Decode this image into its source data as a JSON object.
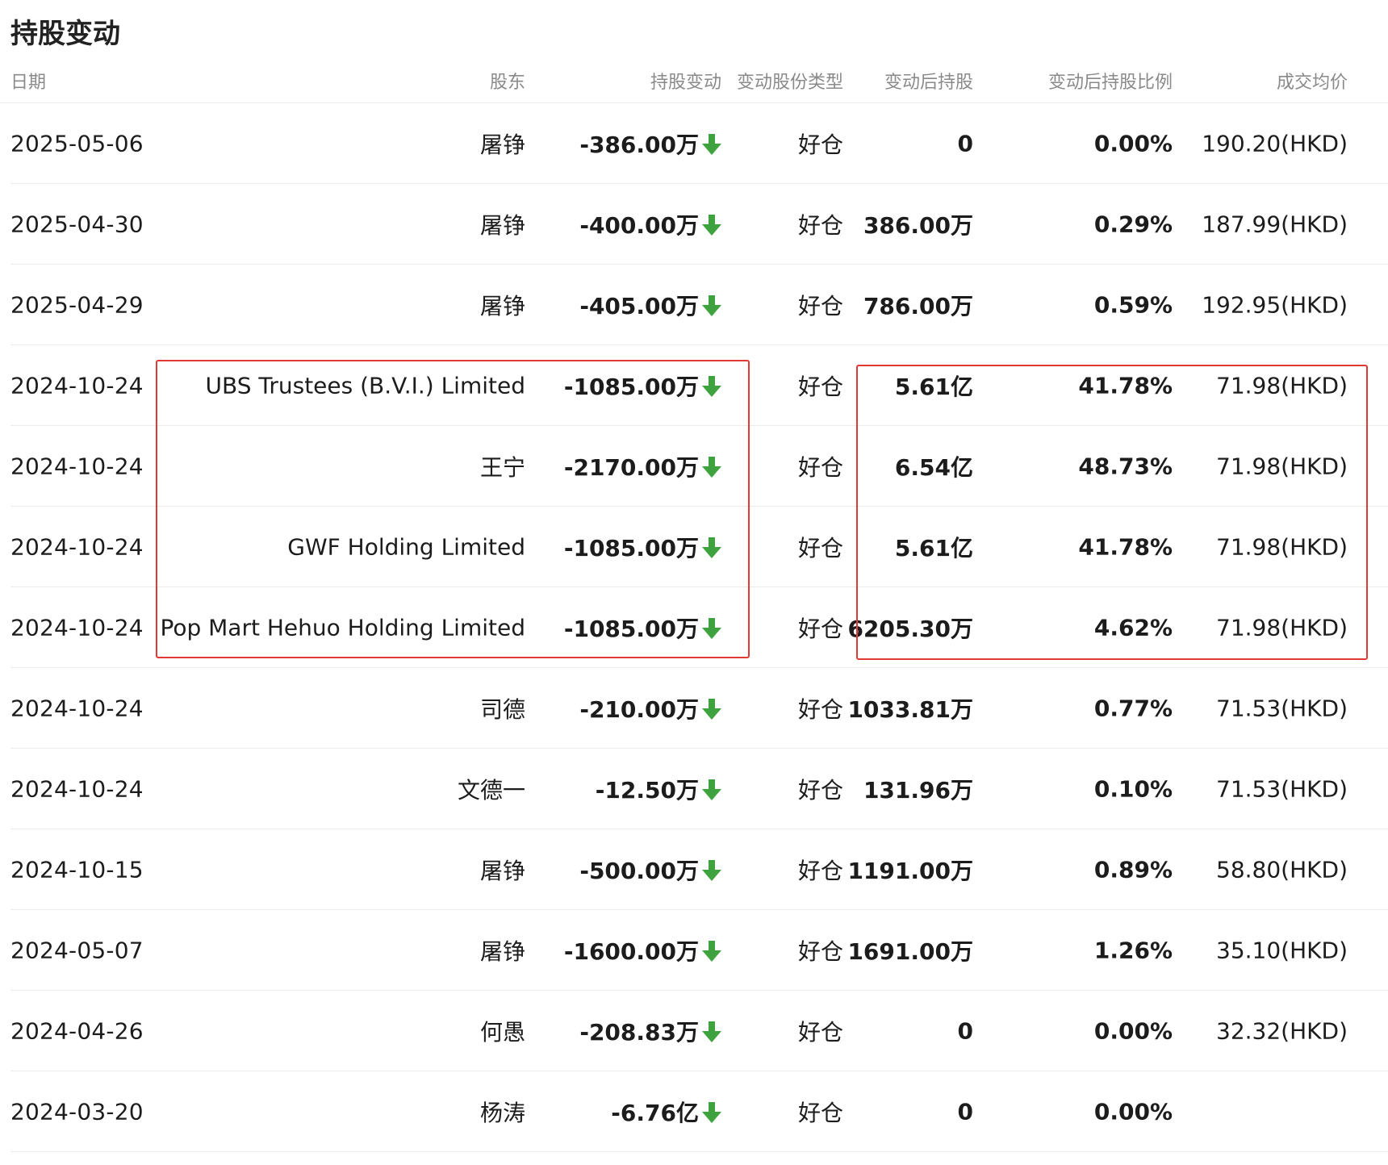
{
  "page": {
    "title": "持股变动"
  },
  "columns": {
    "date": "日期",
    "holder": "股东",
    "change": "持股变动",
    "share_type": "变动股份类型",
    "after_holding": "变动后持股",
    "after_ratio": "变动后持股比例",
    "avg_price": "成交均价"
  },
  "rows": [
    {
      "date": "2025-05-06",
      "holder": "屠铮",
      "change": "-386.00万",
      "share_type": "好仓",
      "after_holding": "0",
      "after_ratio": "0.00%",
      "avg_price": "190.20(HKD)"
    },
    {
      "date": "2025-04-30",
      "holder": "屠铮",
      "change": "-400.00万",
      "share_type": "好仓",
      "after_holding": "386.00万",
      "after_ratio": "0.29%",
      "avg_price": "187.99(HKD)"
    },
    {
      "date": "2025-04-29",
      "holder": "屠铮",
      "change": "-405.00万",
      "share_type": "好仓",
      "after_holding": "786.00万",
      "after_ratio": "0.59%",
      "avg_price": "192.95(HKD)"
    },
    {
      "date": "2024-10-24",
      "holder": "UBS Trustees (B.V.I.) Limited",
      "change": "-1085.00万",
      "share_type": "好仓",
      "after_holding": "5.61亿",
      "after_ratio": "41.78%",
      "avg_price": "71.98(HKD)"
    },
    {
      "date": "2024-10-24",
      "holder": "王宁",
      "change": "-2170.00万",
      "share_type": "好仓",
      "after_holding": "6.54亿",
      "after_ratio": "48.73%",
      "avg_price": "71.98(HKD)"
    },
    {
      "date": "2024-10-24",
      "holder": "GWF Holding Limited",
      "change": "-1085.00万",
      "share_type": "好仓",
      "after_holding": "5.61亿",
      "after_ratio": "41.78%",
      "avg_price": "71.98(HKD)"
    },
    {
      "date": "2024-10-24",
      "holder": "Pop Mart Hehuo Holding Limited",
      "change": "-1085.00万",
      "share_type": "好仓",
      "after_holding": "6205.30万",
      "after_ratio": "4.62%",
      "avg_price": "71.98(HKD)"
    },
    {
      "date": "2024-10-24",
      "holder": "司德",
      "change": "-210.00万",
      "share_type": "好仓",
      "after_holding": "1033.81万",
      "after_ratio": "0.77%",
      "avg_price": "71.53(HKD)"
    },
    {
      "date": "2024-10-24",
      "holder": "文德一",
      "change": "-12.50万",
      "share_type": "好仓",
      "after_holding": "131.96万",
      "after_ratio": "0.10%",
      "avg_price": "71.53(HKD)"
    },
    {
      "date": "2024-10-15",
      "holder": "屠铮",
      "change": "-500.00万",
      "share_type": "好仓",
      "after_holding": "1191.00万",
      "after_ratio": "0.89%",
      "avg_price": "58.80(HKD)"
    },
    {
      "date": "2024-05-07",
      "holder": "屠铮",
      "change": "-1600.00万",
      "share_type": "好仓",
      "after_holding": "1691.00万",
      "after_ratio": "1.26%",
      "avg_price": "35.10(HKD)"
    },
    {
      "date": "2024-04-26",
      "holder": "何愚",
      "change": "-208.83万",
      "share_type": "好仓",
      "after_holding": "0",
      "after_ratio": "0.00%",
      "avg_price": "32.32(HKD)"
    },
    {
      "date": "2024-03-20",
      "holder": "杨涛",
      "change": "-6.76亿",
      "share_type": "好仓",
      "after_holding": "0",
      "after_ratio": "0.00%",
      "avg_price": ""
    }
  ],
  "icons": {
    "change_direction": "arrow-down-icon"
  },
  "colors": {
    "down_arrow": "#3ea33e",
    "highlight_box": "#e03a33"
  }
}
